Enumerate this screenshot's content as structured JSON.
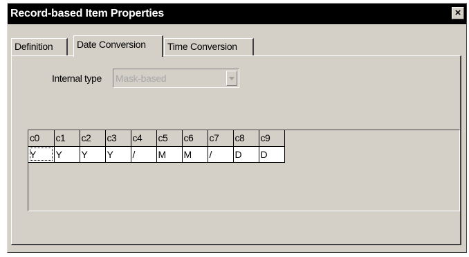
{
  "window": {
    "title": "Record-based Item Properties",
    "close_glyph": "×"
  },
  "tabs": [
    {
      "label": "Definition",
      "active": false
    },
    {
      "label": "Date Conversion",
      "active": true
    },
    {
      "label": "Time Conversion",
      "active": false
    }
  ],
  "form": {
    "internal_type_label": "Internal type",
    "internal_type_value": "Mask-based",
    "internal_type_disabled": true
  },
  "grid": {
    "headers": [
      "c0",
      "c1",
      "c2",
      "c3",
      "c4",
      "c5",
      "c6",
      "c7",
      "c8",
      "c9"
    ],
    "row": [
      "Y",
      "Y",
      "Y",
      "Y",
      "/",
      "M",
      "M",
      "/",
      "D",
      "D"
    ],
    "selected_index": 0
  },
  "colors": {
    "dialog_bg": "#d4d0c8",
    "titlebar_bg": "#000000",
    "cell_bg": "#ffffff"
  },
  "icons": {
    "close": "close-icon",
    "dropdown": "chevron-down-icon"
  }
}
